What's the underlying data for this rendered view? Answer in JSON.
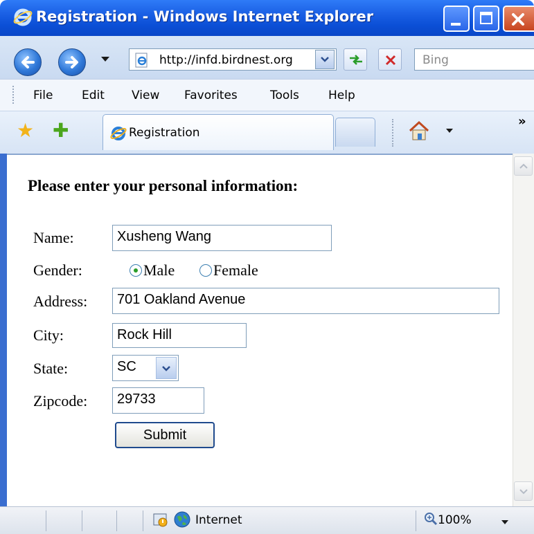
{
  "window": {
    "title": "Registration - Windows Internet Explorer"
  },
  "navigation": {
    "address": "http://infd.birdnest.org",
    "search_placeholder": "Bing"
  },
  "menu": [
    "File",
    "Edit",
    "View",
    "Favorites",
    "Tools",
    "Help"
  ],
  "tabs": {
    "active_label": "Registration"
  },
  "form": {
    "heading": "Please enter your personal information:",
    "name_label": "Name:",
    "name_value": "Xusheng Wang",
    "gender_label": "Gender:",
    "gender_options": [
      "Male",
      "Female"
    ],
    "gender_selected": "Male",
    "address_label": "Address:",
    "address_value": "701 Oakland Avenue",
    "city_label": "City:",
    "city_value": "Rock Hill",
    "state_label": "State:",
    "state_value": "SC",
    "zipcode_label": "Zipcode:",
    "zipcode_value": "29733",
    "submit_label": "Submit"
  },
  "status": {
    "zone": "Internet",
    "zoom": "100%"
  },
  "icons": {
    "ie": "ie-logo-icon",
    "back": "back-arrow-icon",
    "forward": "forward-arrow-icon",
    "refresh": "refresh-icon",
    "stop": "stop-icon",
    "favorites": "star-icon",
    "add_favorites": "add-favorites-icon",
    "home": "home-icon",
    "globe": "globe-icon",
    "zoom": "magnifier-icon"
  },
  "colors": {
    "titlebar": "#0b4fd6",
    "close_button": "#c84520"
  }
}
